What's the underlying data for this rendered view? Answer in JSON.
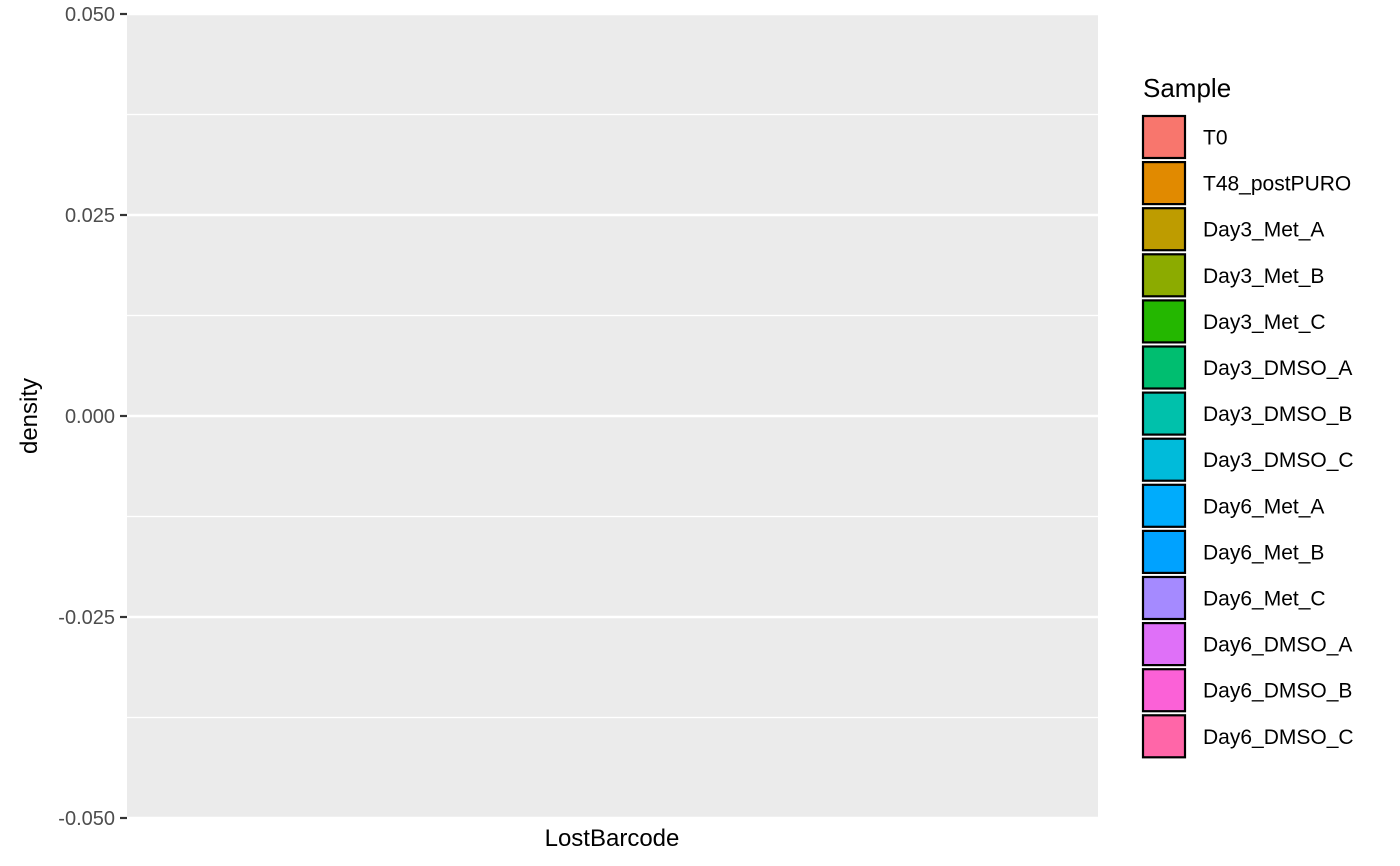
{
  "chart_data": {
    "type": "area",
    "title": "",
    "xlabel": "LostBarcode",
    "ylabel": "density",
    "ylim": [
      -0.05,
      0.05
    ],
    "y_ticks": [
      -0.05,
      -0.025,
      0.0,
      0.025,
      0.05
    ],
    "y_tick_labels": [
      "-0.050",
      "-0.025",
      "0.000",
      "0.025",
      "0.050"
    ],
    "x_ticks": [],
    "grid": true,
    "panel_background": "#EBEBEB",
    "legend": {
      "title": "Sample",
      "placement": "right",
      "entries": [
        {
          "name": "T0",
          "color": "#F8766D"
        },
        {
          "name": "T48_postPURO",
          "color": "#E18A00"
        },
        {
          "name": "Day3_Met_A",
          "color": "#BE9C00"
        },
        {
          "name": "Day3_Met_B",
          "color": "#8CAB00"
        },
        {
          "name": "Day3_Met_C",
          "color": "#24B700"
        },
        {
          "name": "Day3_DMSO_A",
          "color": "#00BE70"
        },
        {
          "name": "Day3_DMSO_B",
          "color": "#00C1AB"
        },
        {
          "name": "Day3_DMSO_C",
          "color": "#00BBDA"
        },
        {
          "name": "Day6_Met_A",
          "color": "#00ACFC"
        },
        {
          "name": "Day6_Met_B",
          "color": "#00A2FF"
        },
        {
          "name": "Day6_Met_C",
          "color": "#A58AFF"
        },
        {
          "name": "Day6_DMSO_A",
          "color": "#DF70F8"
        },
        {
          "name": "Day6_DMSO_B",
          "color": "#FB61D7"
        },
        {
          "name": "Day6_DMSO_C",
          "color": "#FF66A8"
        }
      ]
    },
    "series": []
  }
}
